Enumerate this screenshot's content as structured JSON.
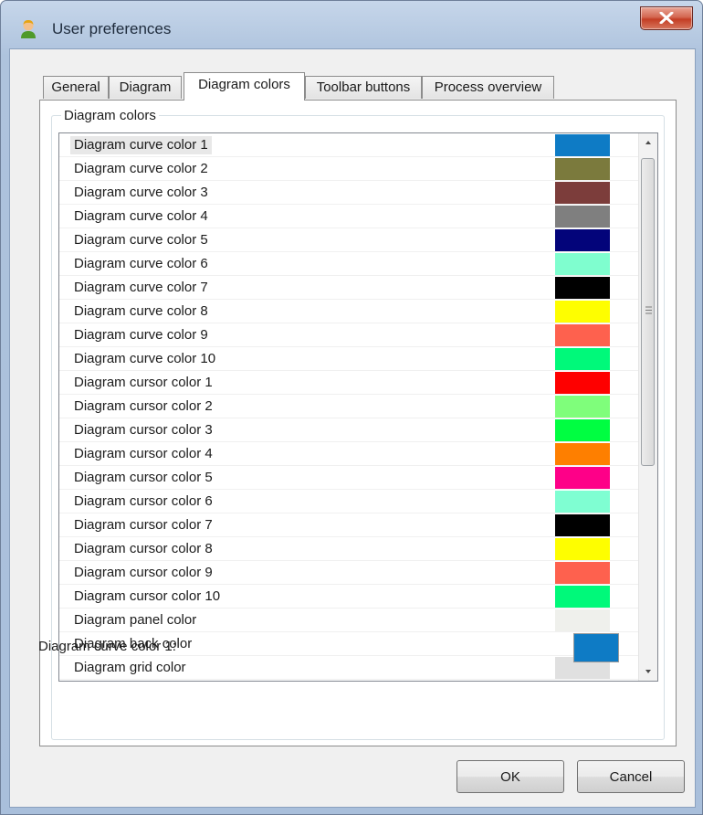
{
  "window": {
    "title": "User preferences"
  },
  "tabs": [
    {
      "label": "General"
    },
    {
      "label": "Diagram"
    },
    {
      "label": "Diagram colors"
    },
    {
      "label": "Toolbar buttons"
    },
    {
      "label": "Process overview"
    }
  ],
  "active_tab": "Diagram colors",
  "group": {
    "title": "Diagram colors"
  },
  "color_list": {
    "selected_index": 0,
    "items": [
      {
        "label": "Diagram curve color 1",
        "color": "#0e7bc5"
      },
      {
        "label": "Diagram curve color 2",
        "color": "#7b7a3d"
      },
      {
        "label": "Diagram curve color 3",
        "color": "#7c3d3b"
      },
      {
        "label": "Diagram curve color 4",
        "color": "#7f7f7f"
      },
      {
        "label": "Diagram curve color 5",
        "color": "#03047a"
      },
      {
        "label": "Diagram curve color 6",
        "color": "#7ffecf"
      },
      {
        "label": "Diagram curve color 7",
        "color": "#000000"
      },
      {
        "label": "Diagram curve color 8",
        "color": "#fefe00"
      },
      {
        "label": "Diagram curve color 9",
        "color": "#fe614e"
      },
      {
        "label": "Diagram curve color 10",
        "color": "#00f97a"
      },
      {
        "label": "Diagram cursor color 1",
        "color": "#fe0000"
      },
      {
        "label": "Diagram cursor color 2",
        "color": "#7ffe7b"
      },
      {
        "label": "Diagram cursor color 3",
        "color": "#00fe41"
      },
      {
        "label": "Diagram cursor color 4",
        "color": "#fe7f00"
      },
      {
        "label": "Diagram cursor color 5",
        "color": "#fe0088"
      },
      {
        "label": "Diagram cursor color 6",
        "color": "#7ffed2"
      },
      {
        "label": "Diagram cursor color 7",
        "color": "#000000"
      },
      {
        "label": "Diagram cursor color 8",
        "color": "#fefe00"
      },
      {
        "label": "Diagram cursor color 9",
        "color": "#fe614e"
      },
      {
        "label": "Diagram cursor color 10",
        "color": "#00f97a"
      },
      {
        "label": "Diagram panel color",
        "color": "#eff0ec"
      },
      {
        "label": "Diagram back color",
        "color": "#ffffff"
      },
      {
        "label": "Diagram grid color",
        "color": "#e0e0e0"
      }
    ]
  },
  "selection_preview": {
    "label": "Diagram curve color 1:",
    "color": "#0e7bc5"
  },
  "buttons": {
    "ok": "OK",
    "cancel": "Cancel"
  }
}
